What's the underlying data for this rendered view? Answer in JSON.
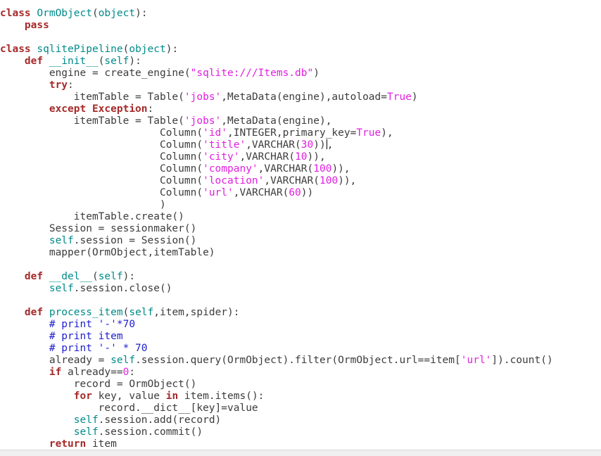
{
  "lines": [
    [
      [
        "kw",
        "class "
      ],
      [
        "cls",
        "OrmObject"
      ],
      [
        "",
        "("
      ],
      [
        "cls",
        "object"
      ],
      [
        "",
        "):"
      ]
    ],
    [
      [
        "",
        "    "
      ],
      [
        "kw",
        "pass"
      ]
    ],
    [],
    [
      [
        "kw",
        "class "
      ],
      [
        "cls",
        "sqlitePipeline"
      ],
      [
        "",
        "("
      ],
      [
        "cls",
        "object"
      ],
      [
        "",
        "):"
      ]
    ],
    [
      [
        "",
        "    "
      ],
      [
        "kw",
        "def "
      ],
      [
        "cls",
        "__init__"
      ],
      [
        "",
        "("
      ],
      [
        "slf",
        "self"
      ],
      [
        "",
        "):"
      ]
    ],
    [
      [
        "",
        "        engine = create_engine("
      ],
      [
        "str",
        "\"sqlite:///Items.db\""
      ],
      [
        "",
        ")"
      ]
    ],
    [
      [
        "",
        "        "
      ],
      [
        "kw",
        "try"
      ],
      [
        "",
        ":"
      ]
    ],
    [
      [
        "",
        "            itemTable = Table("
      ],
      [
        "str",
        "'jobs'"
      ],
      [
        "",
        ",MetaData(engine),autoload="
      ],
      [
        "num",
        "True"
      ],
      [
        "",
        ")"
      ]
    ],
    [
      [
        "",
        "        "
      ],
      [
        "kw",
        "except "
      ],
      [
        "kw",
        "Exception"
      ],
      [
        "",
        ":"
      ]
    ],
    [
      [
        "",
        "            itemTable = Table("
      ],
      [
        "str",
        "'jobs'"
      ],
      [
        "",
        ",MetaData(engine),"
      ]
    ],
    [
      [
        "",
        "                          Column("
      ],
      [
        "str",
        "'id'"
      ],
      [
        "",
        ",INTEGER,primary_key="
      ],
      [
        "num",
        "True"
      ],
      [
        "",
        "),"
      ]
    ],
    [
      [
        "",
        "                          Column("
      ],
      [
        "str",
        "'title'"
      ],
      [
        "",
        ",VARCHAR("
      ],
      [
        "num",
        "30"
      ],
      [
        "",
        "))"
      ],
      [
        "cursor",
        ""
      ],
      [
        "",
        ","
      ]
    ],
    [
      [
        "",
        "                          Column("
      ],
      [
        "str",
        "'city'"
      ],
      [
        "",
        ",VARCHAR("
      ],
      [
        "num",
        "10"
      ],
      [
        "",
        "))"
      ],
      [
        "",
        ","
      ]
    ],
    [
      [
        "",
        "                          Column("
      ],
      [
        "str",
        "'company'"
      ],
      [
        "",
        ",VARCHAR("
      ],
      [
        "num",
        "100"
      ],
      [
        "",
        "))"
      ],
      [
        "",
        ","
      ]
    ],
    [
      [
        "",
        "                          Column("
      ],
      [
        "str",
        "'location'"
      ],
      [
        "",
        ",VARCHAR("
      ],
      [
        "num",
        "100"
      ],
      [
        "",
        "))"
      ],
      [
        "",
        ","
      ]
    ],
    [
      [
        "",
        "                          Column("
      ],
      [
        "str",
        "'url'"
      ],
      [
        "",
        ",VARCHAR("
      ],
      [
        "num",
        "60"
      ],
      [
        "",
        "))"
      ]
    ],
    [
      [
        "",
        "                          )"
      ]
    ],
    [
      [
        "",
        "            itemTable.create()"
      ]
    ],
    [
      [
        "",
        "        Session = sessionmaker()"
      ]
    ],
    [
      [
        "",
        "        "
      ],
      [
        "slf",
        "self"
      ],
      [
        "",
        ".session = Session()"
      ]
    ],
    [
      [
        "",
        "        mapper(OrmObject,itemTable)"
      ]
    ],
    [],
    [
      [
        "",
        "    "
      ],
      [
        "kw",
        "def "
      ],
      [
        "cls",
        "__del__"
      ],
      [
        "",
        "("
      ],
      [
        "slf",
        "self"
      ],
      [
        "",
        "):"
      ]
    ],
    [
      [
        "",
        "        "
      ],
      [
        "slf",
        "self"
      ],
      [
        "",
        ".session.close()"
      ]
    ],
    [],
    [
      [
        "",
        "    "
      ],
      [
        "kw",
        "def "
      ],
      [
        "cls",
        "process_item"
      ],
      [
        "",
        "("
      ],
      [
        "slf",
        "self"
      ],
      [
        "",
        ",item,spider):"
      ]
    ],
    [
      [
        "",
        "        "
      ],
      [
        "com",
        "# print '-'*70"
      ]
    ],
    [
      [
        "",
        "        "
      ],
      [
        "com",
        "# print item"
      ]
    ],
    [
      [
        "",
        "        "
      ],
      [
        "com",
        "# print '-' * 70"
      ]
    ],
    [
      [
        "",
        "        already = "
      ],
      [
        "slf",
        "self"
      ],
      [
        "",
        ".session.query(OrmObject).filter(OrmObject.url==item["
      ],
      [
        "str",
        "'url'"
      ],
      [
        "",
        "]).count()"
      ]
    ],
    [
      [
        "",
        "        "
      ],
      [
        "kw",
        "if "
      ],
      [
        "",
        "already=="
      ],
      [
        "num",
        "0"
      ],
      [
        "",
        ":"
      ]
    ],
    [
      [
        "",
        "            record = OrmObject()"
      ]
    ],
    [
      [
        "",
        "            "
      ],
      [
        "kw",
        "for "
      ],
      [
        "",
        "key, value "
      ],
      [
        "kw",
        "in "
      ],
      [
        "",
        "item.items():"
      ]
    ],
    [
      [
        "",
        "                record.__dict__[key]=value"
      ]
    ],
    [
      [
        "",
        "            "
      ],
      [
        "slf",
        "self"
      ],
      [
        "",
        ".session.add(record)"
      ]
    ],
    [
      [
        "",
        "            "
      ],
      [
        "slf",
        "self"
      ],
      [
        "",
        ".session.commit()"
      ]
    ],
    [
      [
        "",
        "        "
      ],
      [
        "kw",
        "return "
      ],
      [
        "",
        "item"
      ]
    ]
  ]
}
